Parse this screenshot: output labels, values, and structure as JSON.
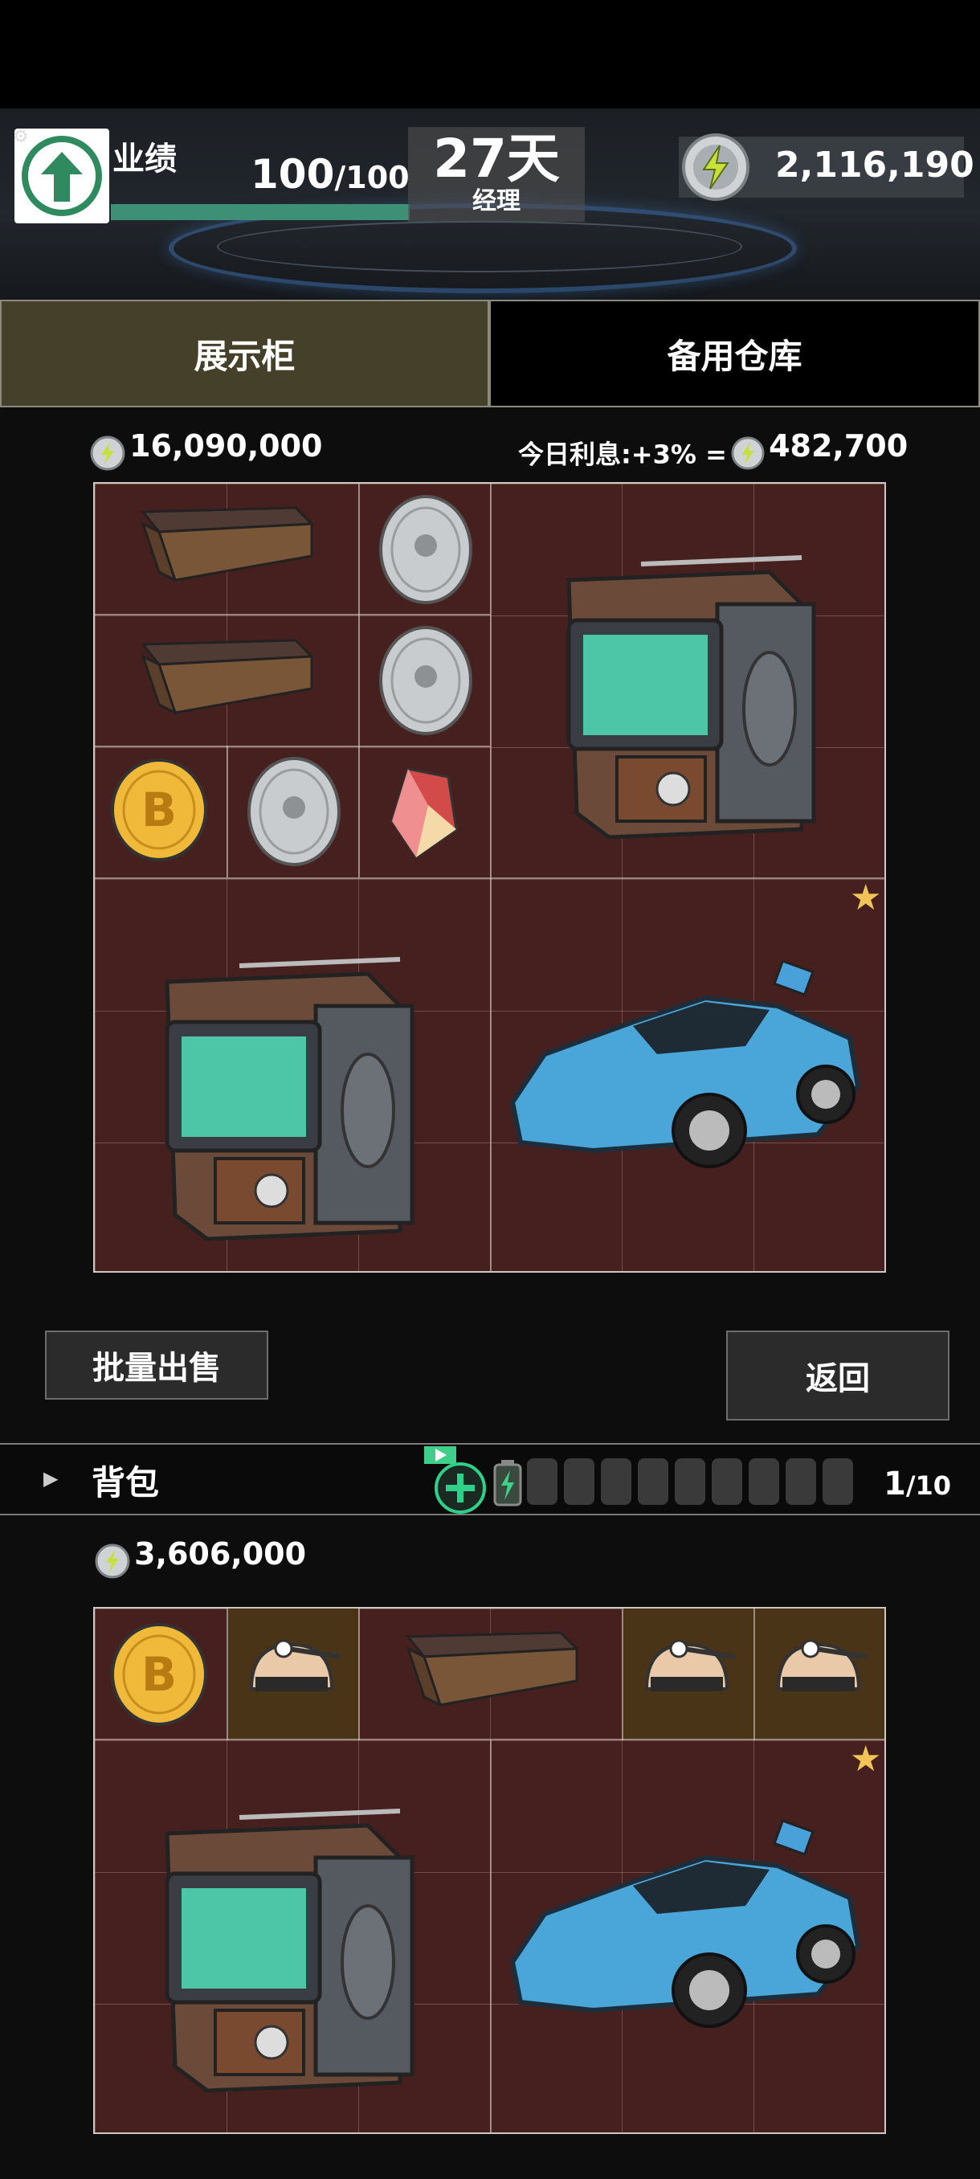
{
  "hud": {
    "performance_label": "业绩",
    "performance_value": "100",
    "performance_max": "/100",
    "performance_fraction": 1.0,
    "days": "27天",
    "rank": "经理",
    "total_coins": "2,116,190"
  },
  "tabs": {
    "display_cabinet": "展示柜",
    "spare_warehouse": "备用仓库"
  },
  "cabinet": {
    "total_value": "16,090,000",
    "interest_label": "今日利息:+3% =",
    "interest_value": "482,700"
  },
  "buttons": {
    "bulk_sell": "批量出售",
    "back": "返回"
  },
  "backpack": {
    "label": "背包",
    "capacity": "1",
    "capacity_max": "/10",
    "value": "3,606,000"
  },
  "icons": [
    "gear-icon",
    "up-arrow-icon",
    "lightning-coin-icon",
    "add-icon",
    "battery-icon",
    "star-icon",
    "play-triangle-icon"
  ],
  "colors": {
    "accent_green": "#3d8f76",
    "grid_bg": "#45201f",
    "tab_active": "#45402a",
    "star": "#f0c456"
  }
}
